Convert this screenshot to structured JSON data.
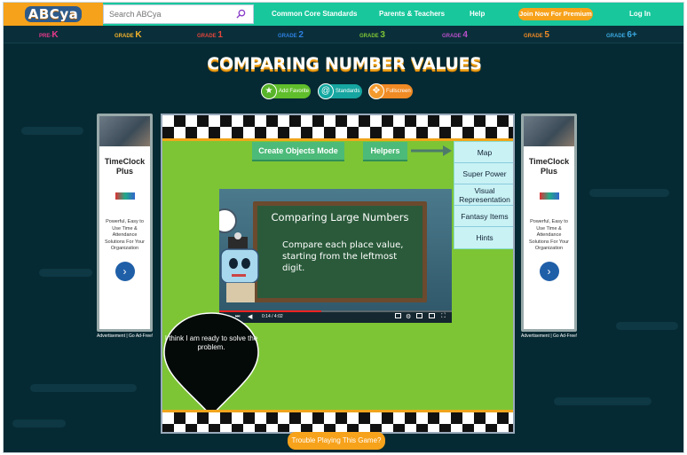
{
  "nav": {
    "logo": "ABCya",
    "search_placeholder": "Search ABCya",
    "links": [
      "Common Core Standards",
      "Parents & Teachers",
      "Help"
    ],
    "premium": "Join Now For Premium",
    "login": "Log In"
  },
  "grades": [
    {
      "small": "PRE-",
      "big": "K",
      "color": "#e8388c"
    },
    {
      "small": "GRADE ",
      "big": "K",
      "color": "#f3b22a"
    },
    {
      "small": "GRADE ",
      "big": "1",
      "color": "#e2453b"
    },
    {
      "small": "GRADE ",
      "big": "2",
      "color": "#2d7fe0"
    },
    {
      "small": "GRADE ",
      "big": "3",
      "color": "#7dc535"
    },
    {
      "small": "GRADE ",
      "big": "4",
      "color": "#b64fc8"
    },
    {
      "small": "GRADE ",
      "big": "5",
      "color": "#f08a24"
    },
    {
      "small": "GRADE ",
      "big": "6+",
      "color": "#3aa8e0"
    }
  ],
  "title": "COMPARING NUMBER VALUES",
  "pills": {
    "favorite": "Add Favorite",
    "standards": "Standards",
    "fullscreen": "Fullscreen"
  },
  "ad": {
    "title": "TimeClock Plus",
    "text": "Powerful, Easy to Use Time & Attendance Solutions For Your Organization",
    "note": "Advertisement | Go Ad-Free!"
  },
  "game": {
    "create_objects": "Create Objects Mode",
    "helpers": "Helpers",
    "menu": [
      "Map",
      "Super Power",
      "Visual Representation",
      "Fantasy Items",
      "Hints"
    ],
    "video": {
      "board_title": "Comparing Large Numbers",
      "board_body": "Compare each place value, starting from the leftmost digit.",
      "time": "0:14 / 4:02",
      "progress": 0.44
    },
    "bubble": "I think I am ready to solve the problem."
  },
  "trouble": "Trouble Playing This Game?"
}
